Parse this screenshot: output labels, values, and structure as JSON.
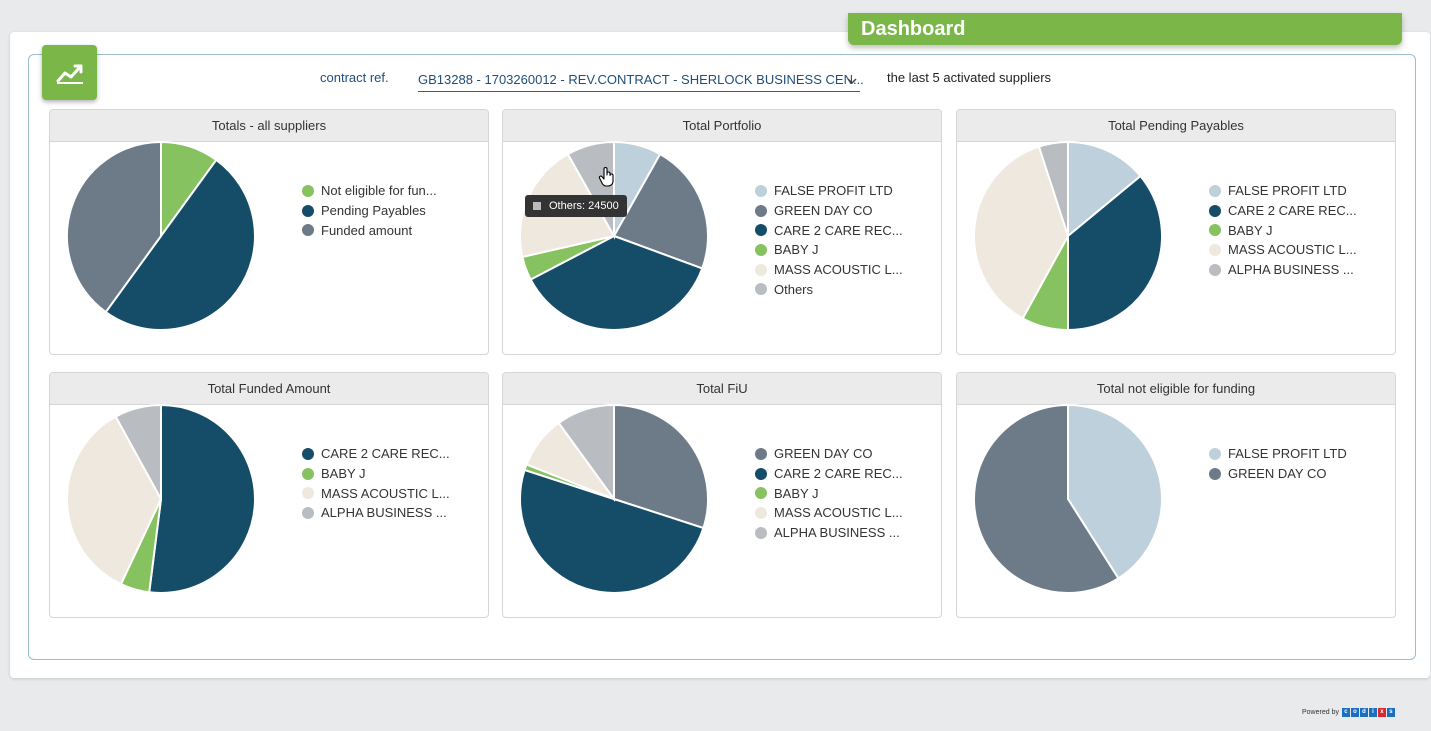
{
  "header": {
    "title": "Dashboard"
  },
  "filters": {
    "contract_label": "contract ref.",
    "contract_value": "GB13288 - 1703260012 - REV.CONTRACT - SHERLOCK BUSINESS CEN...",
    "last_label": "the last 5  activated suppliers"
  },
  "colors": {
    "green": "#86c260",
    "navy": "#154c68",
    "slate": "#6d7a88",
    "lightblue": "#bdd0db",
    "beige": "#efe8df",
    "gray": "#b9bcc0",
    "accent": "#7ab648"
  },
  "charts": [
    {
      "title": "Totals - all suppliers",
      "slices": [
        {
          "label": "Not eligible for fun...",
          "color": "green",
          "value": 10
        },
        {
          "label": "Pending Payables",
          "color": "navy",
          "value": 50
        },
        {
          "label": "Funded amount",
          "color": "slate",
          "value": 40
        }
      ]
    },
    {
      "title": "Total Portfolio",
      "slices": [
        {
          "label": "FALSE PROFIT LTD",
          "color": "lightblue",
          "value": 8
        },
        {
          "label": "GREEN DAY CO",
          "color": "slate",
          "value": 22
        },
        {
          "label": "CARE 2 CARE REC...",
          "color": "navy",
          "value": 36
        },
        {
          "label": "BABY J",
          "color": "green",
          "value": 4
        },
        {
          "label": "MASS ACOUSTIC L...",
          "color": "beige",
          "value": 20
        },
        {
          "label": "Others",
          "color": "gray",
          "value": 8
        }
      ]
    },
    {
      "title": "Total Pending Payables",
      "slices": [
        {
          "label": "FALSE PROFIT LTD",
          "color": "lightblue",
          "value": 14
        },
        {
          "label": "CARE 2 CARE REC...",
          "color": "navy",
          "value": 36
        },
        {
          "label": "BABY J",
          "color": "green",
          "value": 8
        },
        {
          "label": "MASS ACOUSTIC L...",
          "color": "beige",
          "value": 37
        },
        {
          "label": "ALPHA BUSINESS ...",
          "color": "gray",
          "value": 5
        }
      ]
    },
    {
      "title": "Total Funded Amount",
      "slices": [
        {
          "label": "CARE 2 CARE REC...",
          "color": "navy",
          "value": 52
        },
        {
          "label": "BABY J",
          "color": "green",
          "value": 5
        },
        {
          "label": "MASS ACOUSTIC L...",
          "color": "beige",
          "value": 35
        },
        {
          "label": "ALPHA BUSINESS ...",
          "color": "gray",
          "value": 8
        }
      ]
    },
    {
      "title": "Total FiU",
      "slices": [
        {
          "label": "GREEN DAY CO",
          "color": "slate",
          "value": 30
        },
        {
          "label": "CARE 2 CARE REC...",
          "color": "navy",
          "value": 50
        },
        {
          "label": "BABY J",
          "color": "green",
          "value": 1
        },
        {
          "label": "MASS ACOUSTIC L...",
          "color": "beige",
          "value": 9
        },
        {
          "label": "ALPHA BUSINESS ...",
          "color": "gray",
          "value": 10
        }
      ]
    },
    {
      "title": "Total not eligible for funding",
      "slices": [
        {
          "label": "FALSE PROFIT LTD",
          "color": "lightblue",
          "value": 41
        },
        {
          "label": "GREEN DAY CO",
          "color": "slate",
          "value": 59
        }
      ]
    }
  ],
  "tooltip": {
    "text": "Others: 24500"
  },
  "footer": {
    "powered_label": "Powered by",
    "logo_letters": [
      "c",
      "o",
      "d",
      "i",
      "x",
      "s"
    ]
  }
}
